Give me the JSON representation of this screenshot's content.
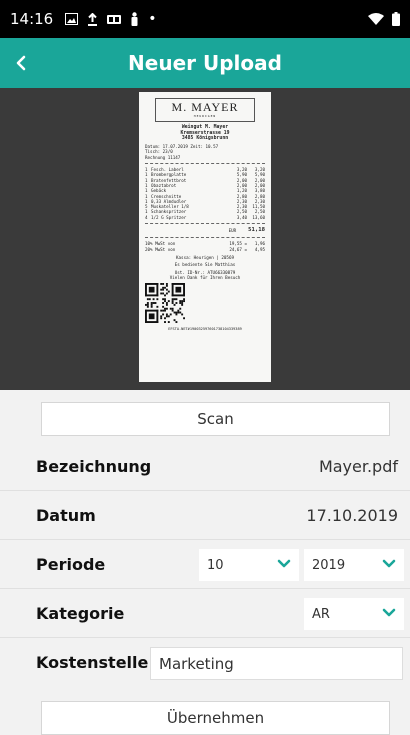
{
  "status_bar": {
    "time": "14:16",
    "dot": "•"
  },
  "app_bar": {
    "back_label": "<",
    "title": "Neuer Upload"
  },
  "receipt": {
    "logo_name": "M. MAYER",
    "logo_sub": "HEURIGEN",
    "header_lines": [
      "Weingut M. Mayer",
      "Kremserstrasse 19",
      "3485 Königsbrunn"
    ],
    "date_line": "Datum: 17.07.2019   Zeit: 10.57",
    "table_line": "Tisch: 23/0",
    "invoice_line": "Rechnung 11147",
    "items": [
      {
        "qty": "1",
        "name": "Fesch. Laberl",
        "price": "3,20",
        "total": "3,20"
      },
      {
        "qty": "1",
        "name": "Brombergplatte",
        "price": "5,90",
        "total": "5,90"
      },
      {
        "qty": "1",
        "name": "Bratenfettbrot",
        "price": "2,00",
        "total": "2,00"
      },
      {
        "qty": "1",
        "name": "Obaztabrot",
        "price": "2,00",
        "total": "2,00"
      },
      {
        "qty": "1",
        "name": "Gebäck",
        "price": "1,20",
        "total": "3,80"
      },
      {
        "qty": "1",
        "name": "Cremschnitte",
        "price": "2,80",
        "total": "2,80"
      },
      {
        "qty": "1",
        "name": "0,33 Almdudler",
        "price": "2,30",
        "total": "2,30"
      },
      {
        "qty": "5",
        "name": "Muskateller 1/8",
        "price": "2,30",
        "total": "11,50"
      },
      {
        "qty": "1",
        "name": "Schankspritzer",
        "price": "2,50",
        "total": "2,50"
      },
      {
        "qty": "4",
        "name": "1/2 G Spritzer",
        "price": "3,40",
        "total": "13,60"
      }
    ],
    "currency": "EUR",
    "total": "51,18",
    "tax_lines": [
      {
        "label": "10% MwSt von",
        "base": "19,55 =",
        "tax": "1,96"
      },
      {
        "label": "20% MwSt von",
        "base": "24,67 =",
        "tax": "4,95"
      }
    ],
    "footer_lines": [
      "Kassa: Heurigen | 20569",
      "Es bediente Sie Matthias",
      "Ust. ID-Nr.: ATU66330879",
      "Vielen Dank für Ihren Besuch"
    ],
    "qr_footer": "EFSTA.NET#190032597601738104339389"
  },
  "form": {
    "scan_label": "Scan",
    "bezeichnung_label": "Bezeichnung",
    "bezeichnung_value": "Mayer.pdf",
    "datum_label": "Datum",
    "datum_value": "17.10.2019",
    "periode_label": "Periode",
    "periode_month": "10",
    "periode_year": "2019",
    "kategorie_label": "Kategorie",
    "kategorie_value": "AR",
    "kostenstelle_label": "Kostenstelle",
    "kostenstelle_value": "Marketing",
    "apply_label": "Übernehmen"
  },
  "colors": {
    "accent": "#1aa699",
    "chevron": "#1aa699"
  }
}
